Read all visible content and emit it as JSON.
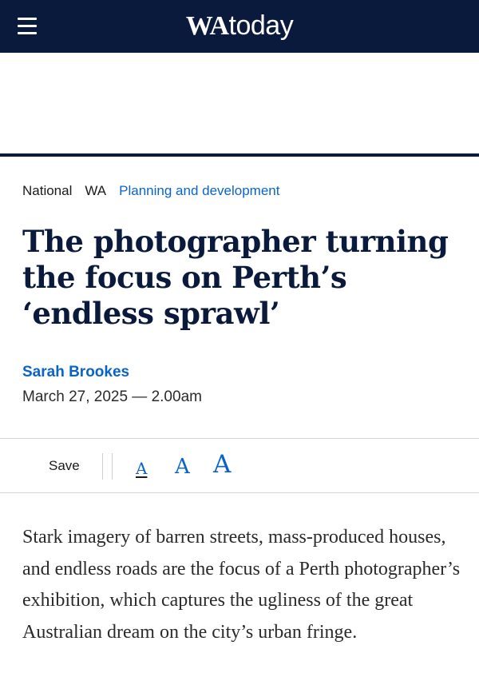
{
  "header": {
    "logo_wa": "WA",
    "logo_today": "today",
    "menu_icon": "hamburger-menu-icon",
    "background_color": "#0a1a3c"
  },
  "breadcrumb": {
    "items": [
      "National",
      "WA",
      "Planning and development"
    ]
  },
  "article": {
    "headline": "The photographer turning the focus on Perth’s ‘endless sprawl’",
    "author": "Sarah Brookes",
    "date": "March 27, 2025 — 2.00am",
    "lead": "Stark imagery of barren streets, mass-produced houses, and endless roads are the focus of a Perth photographer’s exhibition, which captures the ugliness of the great Australian dream on the city’s urban fringe."
  },
  "toolbar": {
    "save_label": "Save",
    "font_size_labels": [
      "A",
      "A",
      "A"
    ]
  },
  "colors": {
    "brand_navy": "#0a1a3c",
    "link_blue": "#0a64c8"
  }
}
